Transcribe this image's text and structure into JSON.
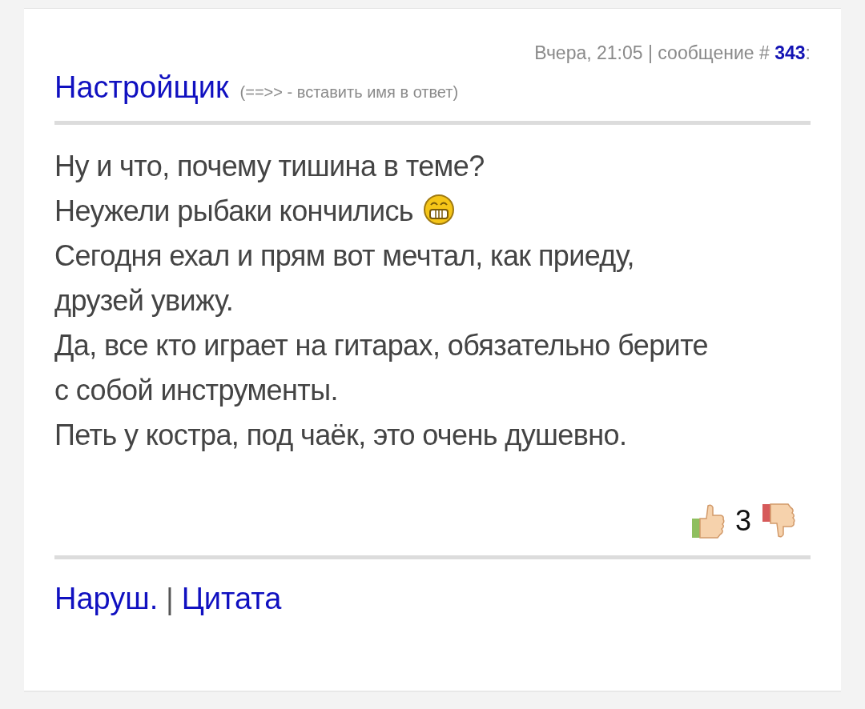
{
  "post": {
    "meta": "Вчера, 21:05 | сообщение # **343**:",
    "author": "Настройщик",
    "author_hint": "(==>> - вставить имя в ответ)",
    "paragraphs": [
      {
        "text": "Ну и что, почему тишина в теме?",
        "emoticon": false
      },
      {
        "text": "Неужели рыбаки кончились",
        "emoticon": true
      },
      {
        "text": "Сегодня ехал и прям вот мечтал, как приеду, друзей увижу.",
        "emoticon": false
      },
      {
        "text": "Да, все кто играет на гитарах, обязательно берите с собой инструменты.",
        "emoticon": false
      },
      {
        "text": "Петь у костра, под чаёк, это очень душевно.",
        "emoticon": false
      }
    ],
    "rating": "3",
    "links": [
      {
        "label": "Наруш."
      },
      {
        "label": "Цитата"
      }
    ],
    "link_separator": "|"
  }
}
